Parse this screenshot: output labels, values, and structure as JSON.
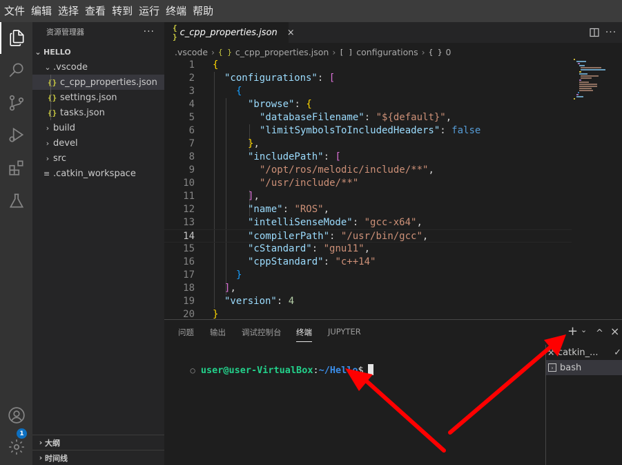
{
  "menubar": [
    "文件",
    "编辑",
    "选择",
    "查看",
    "转到",
    "运行",
    "终端",
    "帮助"
  ],
  "activitybar": {
    "icons": [
      "explorer-icon",
      "search-icon",
      "source-control-icon",
      "run-debug-icon",
      "extensions-icon",
      "testing-icon",
      "account-icon",
      "manage-gear-icon"
    ],
    "badge": "1"
  },
  "sidebar": {
    "title": "资源管理器",
    "more": "···",
    "root": "HELLO",
    "tree": [
      {
        "label": ".vscode",
        "kind": "folder-open"
      },
      {
        "label": "c_cpp_properties.json",
        "kind": "json",
        "selected": true
      },
      {
        "label": "settings.json",
        "kind": "json"
      },
      {
        "label": "tasks.json",
        "kind": "json"
      },
      {
        "label": "build",
        "kind": "folder"
      },
      {
        "label": "devel",
        "kind": "folder"
      },
      {
        "label": "src",
        "kind": "folder"
      },
      {
        "label": ".catkin_workspace",
        "kind": "file"
      }
    ],
    "outline": "大纲",
    "timeline": "时间线"
  },
  "editor": {
    "tab": {
      "icon": "{ }",
      "label": "c_cpp_properties.json",
      "close": "×"
    },
    "breadcrumb": [
      ".vscode",
      "c_cpp_properties.json",
      "configurations",
      "0"
    ],
    "breadcrumb_icons": [
      "{ }",
      "[ ]",
      "{ }"
    ],
    "current_line": 14,
    "line_numbers": [
      "1",
      "2",
      "3",
      "4",
      "5",
      "6",
      "7",
      "8",
      "9",
      "10",
      "11",
      "12",
      "13",
      "14",
      "15",
      "16",
      "17",
      "18",
      "19",
      "20"
    ],
    "lines": [
      "{",
      "\"configurations\": [",
      "{",
      "\"browse\": {",
      "\"databaseFilename\": \"${default}\",",
      "\"limitSymbolsToIncludedHeaders\": false",
      "},",
      "\"includePath\": [",
      "\"/opt/ros/melodic/include/**\",",
      "\"/usr/include/**\"",
      "],",
      "\"name\": \"ROS\",",
      "\"intelliSenseMode\": \"gcc-x64\",",
      "\"compilerPath\": \"/usr/bin/gcc\",",
      "\"cStandard\": \"gnu11\",",
      "\"cppStandard\": \"c++14\"",
      "}",
      "],",
      "\"version\": 4",
      "}"
    ]
  },
  "panel": {
    "tabs": [
      "问题",
      "输出",
      "调试控制台",
      "终端",
      "JUPYTER"
    ],
    "active_tab": "终端",
    "terminal": {
      "dot": "○",
      "user": "user@user-VirtualBox",
      "colon": ":",
      "path": "~/Hello",
      "dollar": "$"
    },
    "terminals": [
      "catkin_...",
      "bash"
    ],
    "actions": {
      "add": "+",
      "dropdown": "⌄",
      "maximize": "^",
      "close": "×"
    }
  },
  "colors": {
    "accent": "#0e70c0",
    "arrow": "#ff0000",
    "terminal_user": "#23d18b",
    "terminal_path": "#3b8eea"
  }
}
